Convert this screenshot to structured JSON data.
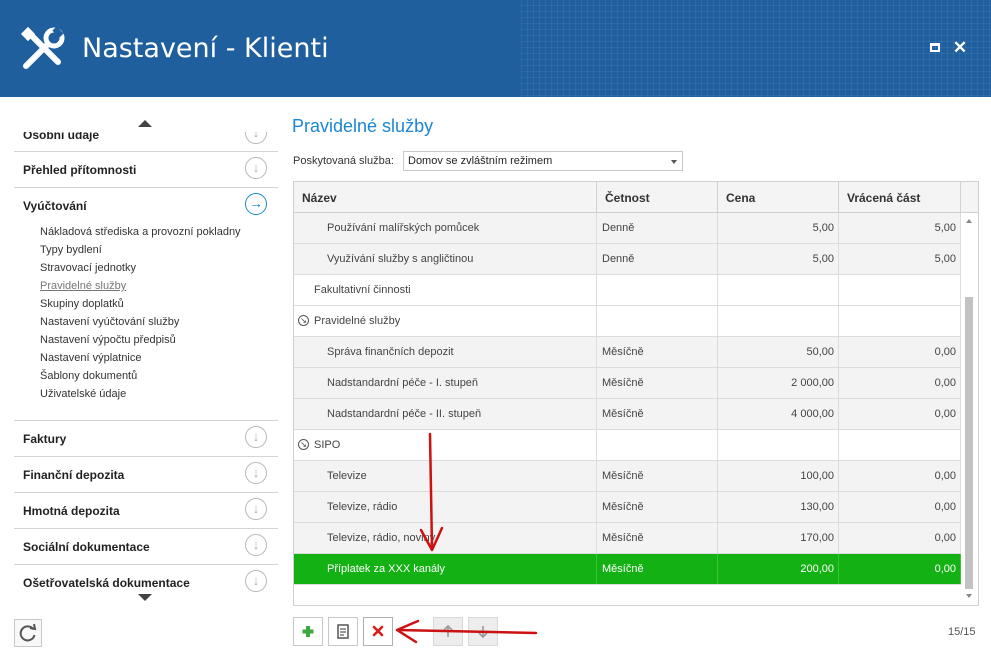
{
  "window": {
    "title": "Nastavení - Klienti",
    "maximize_icon": "maximize-icon",
    "close_icon": "close-icon",
    "close_glyph": "✕"
  },
  "sidebar": {
    "sections": [
      {
        "label": "Osobní údaje",
        "icon": "arrow-down-circle-icon"
      },
      {
        "label": "Přehled přítomnosti",
        "icon": "arrow-down-circle-icon"
      },
      {
        "label": "Vyúčtování",
        "icon": "arrow-right-circle-icon",
        "active": true,
        "items": [
          "Nákladová střediska a provozní pokladny",
          "Typy bydlení",
          "Stravovací jednotky",
          "Pravidelné služby",
          "Skupiny doplatků",
          "Nastavení vyúčtování služby",
          "Nastavení výpočtu předpisů",
          "Nastavení výplatnice",
          "Šablony dokumentů",
          "Uživatelské údaje"
        ],
        "current_item": "Pravidelné služby"
      },
      {
        "label": "Faktury",
        "icon": "arrow-down-circle-icon"
      },
      {
        "label": "Finanční depozita",
        "icon": "arrow-down-circle-icon"
      },
      {
        "label": "Hmotná depozita",
        "icon": "arrow-down-circle-icon"
      },
      {
        "label": "Sociální dokumentace",
        "icon": "arrow-down-circle-icon"
      },
      {
        "label": "Ošetřovatelská dokumentace",
        "icon": "arrow-down-circle-icon"
      }
    ]
  },
  "main": {
    "title": "Pravidelné služby",
    "service_label": "Poskytovaná služba:",
    "service_value": "Domov se zvláštním režimem",
    "columns": [
      "Název",
      "Četnost",
      "Cena",
      "Vrácená část"
    ],
    "rows": [
      {
        "type": "child",
        "name": "Používání malířských pomůcek",
        "freq": "Denně",
        "price": "5,00",
        "ret": "5,00"
      },
      {
        "type": "child",
        "name": "Využívání služby s angličtinou",
        "freq": "Denně",
        "price": "5,00",
        "ret": "5,00"
      },
      {
        "type": "category",
        "name": "Fakultativní činnosti",
        "freq": "",
        "price": "",
        "ret": ""
      },
      {
        "type": "group",
        "name": "Pravidelné služby",
        "freq": "",
        "price": "",
        "ret": ""
      },
      {
        "type": "child",
        "name": "Správa finančních depozit",
        "freq": "Měsíčně",
        "price": "50,00",
        "ret": "0,00"
      },
      {
        "type": "child",
        "name": "Nadstandardní péče - I. stupeň",
        "freq": "Měsíčně",
        "price": "2 000,00",
        "ret": "0,00"
      },
      {
        "type": "child",
        "name": "Nadstandardní péče - II. stupeň",
        "freq": "Měsíčně",
        "price": "4 000,00",
        "ret": "0,00"
      },
      {
        "type": "group",
        "name": "SIPO",
        "freq": "",
        "price": "",
        "ret": ""
      },
      {
        "type": "child",
        "name": "Televize",
        "freq": "Měsíčně",
        "price": "100,00",
        "ret": "0,00"
      },
      {
        "type": "child",
        "name": "Televize, rádio",
        "freq": "Měsíčně",
        "price": "130,00",
        "ret": "0,00"
      },
      {
        "type": "child",
        "name": "Televize, rádio, noviny",
        "freq": "Měsíčně",
        "price": "170,00",
        "ret": "0,00"
      },
      {
        "type": "selected",
        "name": "Příplatek za XXX kanály",
        "freq": "Měsíčně",
        "price": "200,00",
        "ret": "0,00"
      }
    ],
    "counter": "15/15"
  },
  "toolbar": {
    "add_icon": "plus-icon",
    "edit_icon": "edit-icon",
    "delete_icon": "delete-x-icon",
    "move_up_icon": "arrow-up-icon",
    "move_down_icon": "arrow-down-icon",
    "refresh_icon": "refresh-icon"
  },
  "colors": {
    "header_bg": "#1f5f9e",
    "accent": "#1b86d1",
    "selected_row": "#14b114",
    "annotation_arrow": "#cc1111"
  }
}
